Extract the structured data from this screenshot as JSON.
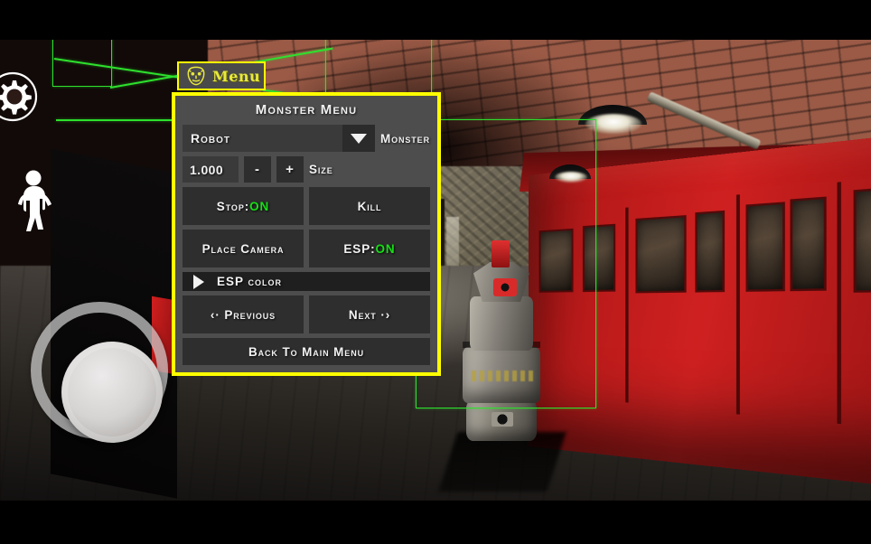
{
  "hud": {
    "settings_icon": "gear-icon",
    "walk_icon": "walking-person-icon",
    "joystick": "virtual-joystick",
    "menu_button": {
      "label": "Menu",
      "icon": "mask-face-icon",
      "border_color": "#ffff00"
    }
  },
  "monster_menu": {
    "title": "Monster Menu",
    "border_color": "#ffff00",
    "panel_color": "#4d4d4d",
    "accent_on_color": "#15e015",
    "monster_select": {
      "value": "Robot",
      "label": "Monster",
      "arrow_icon": "chevron-down-icon",
      "options": [
        "Robot"
      ]
    },
    "size_field": {
      "value": "1.000",
      "label": "Size",
      "decrement_label": "-",
      "increment_label": "+"
    },
    "buttons": {
      "stop_prefix": "Stop:",
      "stop_state": "ON",
      "kill": "Kill",
      "place_camera": "Place Camera",
      "esp_prefix": "ESP:",
      "esp_state": "ON",
      "esp_color": "ESP color",
      "esp_color_icon": "triangle-right-icon",
      "previous": "‹· Previous",
      "next": "Next ·›",
      "back_to_main": "Back To Main Menu"
    }
  },
  "scene": {
    "description": "underground subway tunnel with red train car",
    "esp_outline_color": "#2ee02e",
    "monster_name": "Robot"
  }
}
